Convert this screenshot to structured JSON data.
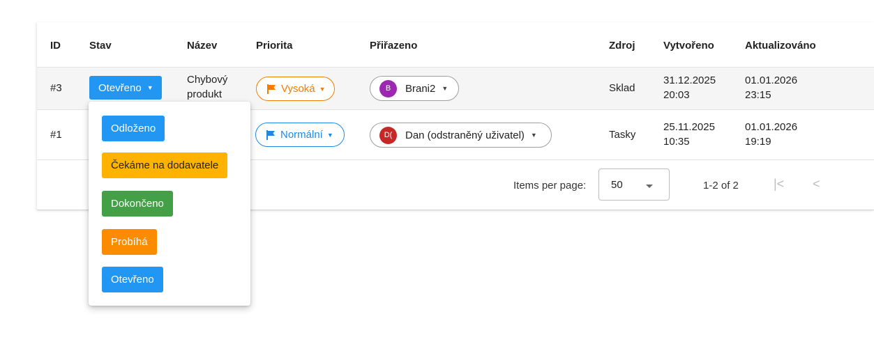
{
  "table": {
    "headers": [
      "ID",
      "Stav",
      "Název",
      "Priorita",
      "Přiřazeno",
      "Zdroj",
      "Vytvořeno",
      "Aktualizováno"
    ],
    "rows": [
      {
        "id": "#3",
        "status": "Otevřeno",
        "name_line1": "Chybový",
        "name_line2": "produkt",
        "priority": "Vysoká",
        "assignee_initials": "B",
        "assignee": "Brani2",
        "source": "Sklad",
        "created_date": "31.12.2025",
        "created_time": "20:03",
        "updated_date": "01.01.2026",
        "updated_time": "23:15"
      },
      {
        "id": "#1",
        "priority": "Normální",
        "assignee_initials": "D(",
        "assignee": "Dan (odstraněný uživatel)",
        "source": "Tasky",
        "created_date": "25.11.2025",
        "created_time": "10:35",
        "updated_date": "01.01.2026",
        "updated_time": "19:19"
      }
    ]
  },
  "pagination": {
    "items_per_page_label": "Items per page:",
    "page_size": "50",
    "range": "1-2 of 2"
  },
  "status_menu": {
    "options": [
      {
        "label": "Odloženo",
        "color": "#2196f3"
      },
      {
        "label": "Čekáme na dodavatele",
        "color": "#ffb300"
      },
      {
        "label": "Dokončeno",
        "color": "#43a047"
      },
      {
        "label": "Probíhá",
        "color": "#fb8c00"
      },
      {
        "label": "Otevřeno",
        "color": "#2196f3"
      }
    ]
  },
  "colors": {
    "status_open": "#2196f3",
    "priority_high": "#f57c00",
    "priority_normal": "#1e88e5",
    "avatar_brani2": "#9c27b0",
    "avatar_dan": "#c62828"
  },
  "icons": {
    "caret": "caret-down-icon",
    "flag": "flag-icon",
    "first_page": "first-page-icon",
    "prev_page": "prev-page-icon",
    "dropdown_arrow": "dropdown-arrow-icon"
  }
}
